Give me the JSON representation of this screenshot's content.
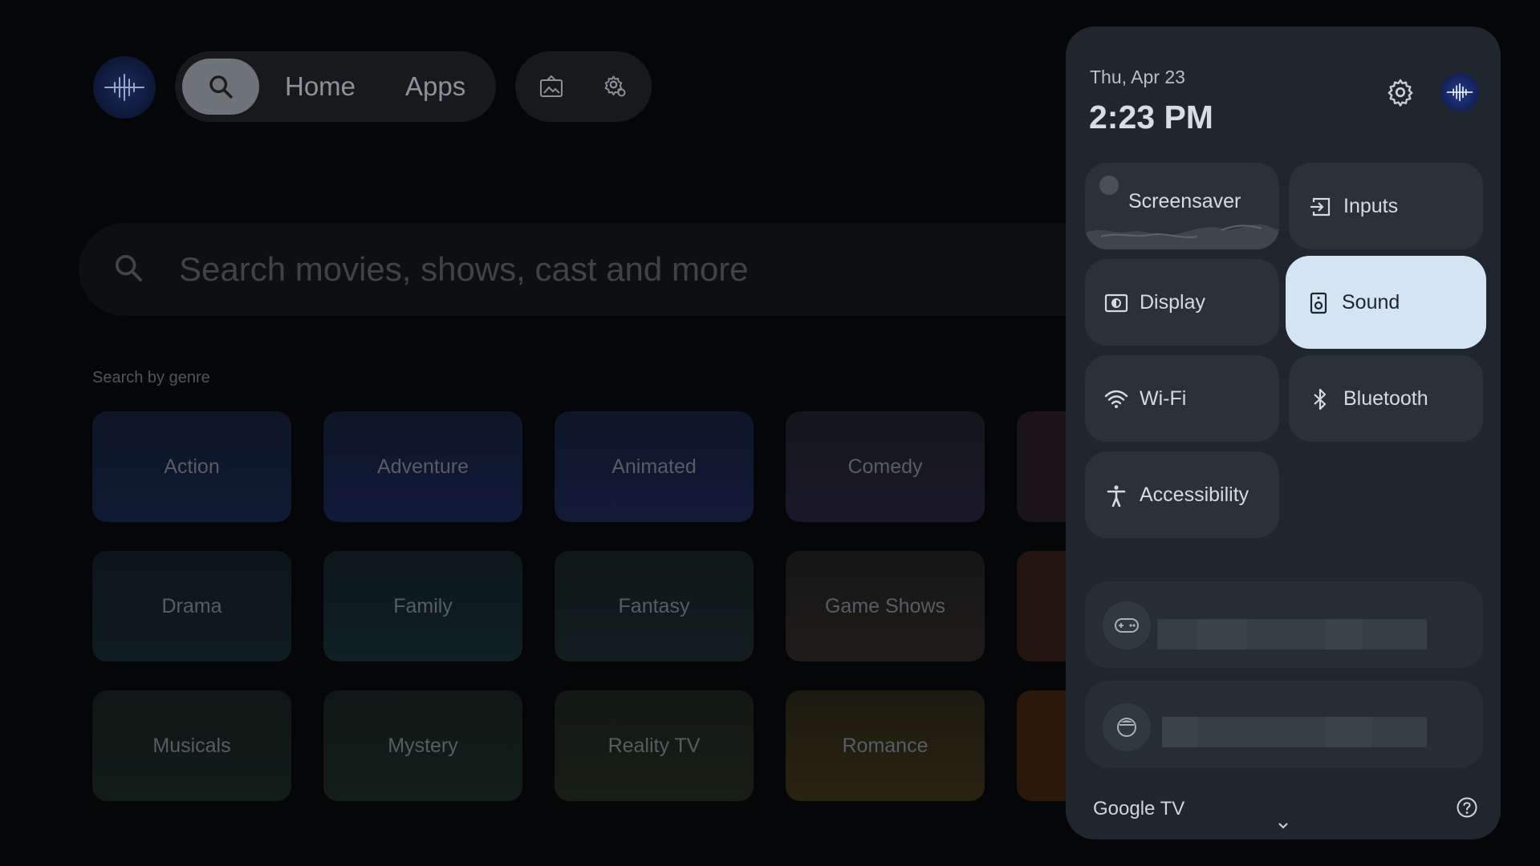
{
  "nav": {
    "home_label": "Home",
    "apps_label": "Apps"
  },
  "search": {
    "placeholder": "Search movies, shows, cast and more"
  },
  "genres": {
    "heading": "Search by genre",
    "items": [
      "Action",
      "Adventure",
      "Animated",
      "Comedy",
      "Drama",
      "Family",
      "Fantasy",
      "Game Shows",
      "Musicals",
      "Mystery",
      "Reality TV",
      "Romance"
    ]
  },
  "panel": {
    "date": "Thu, Apr 23",
    "time": "2:23 PM",
    "tiles": {
      "screensaver": "Screensaver",
      "inputs": "Inputs",
      "display": "Display",
      "sound": "Sound",
      "wifi": "Wi-Fi",
      "bluetooth": "Bluetooth",
      "accessibility": "Accessibility"
    },
    "active_tile": "sound",
    "footer_brand": "Google TV"
  },
  "colors": {
    "panel_bg": "#1f262d",
    "tile_bg": "#2a3139",
    "active_tile_bg": "#d5e4f3",
    "page_bg": "#050607"
  },
  "icons": [
    "search-icon",
    "photo-frame-icon",
    "settings-gear-icon",
    "gear-icon",
    "input-icon",
    "display-icon",
    "speaker-icon",
    "wifi-icon",
    "bluetooth-icon",
    "accessibility-icon",
    "gamepad-icon",
    "device-icon",
    "help-icon",
    "chevron-down-icon"
  ]
}
